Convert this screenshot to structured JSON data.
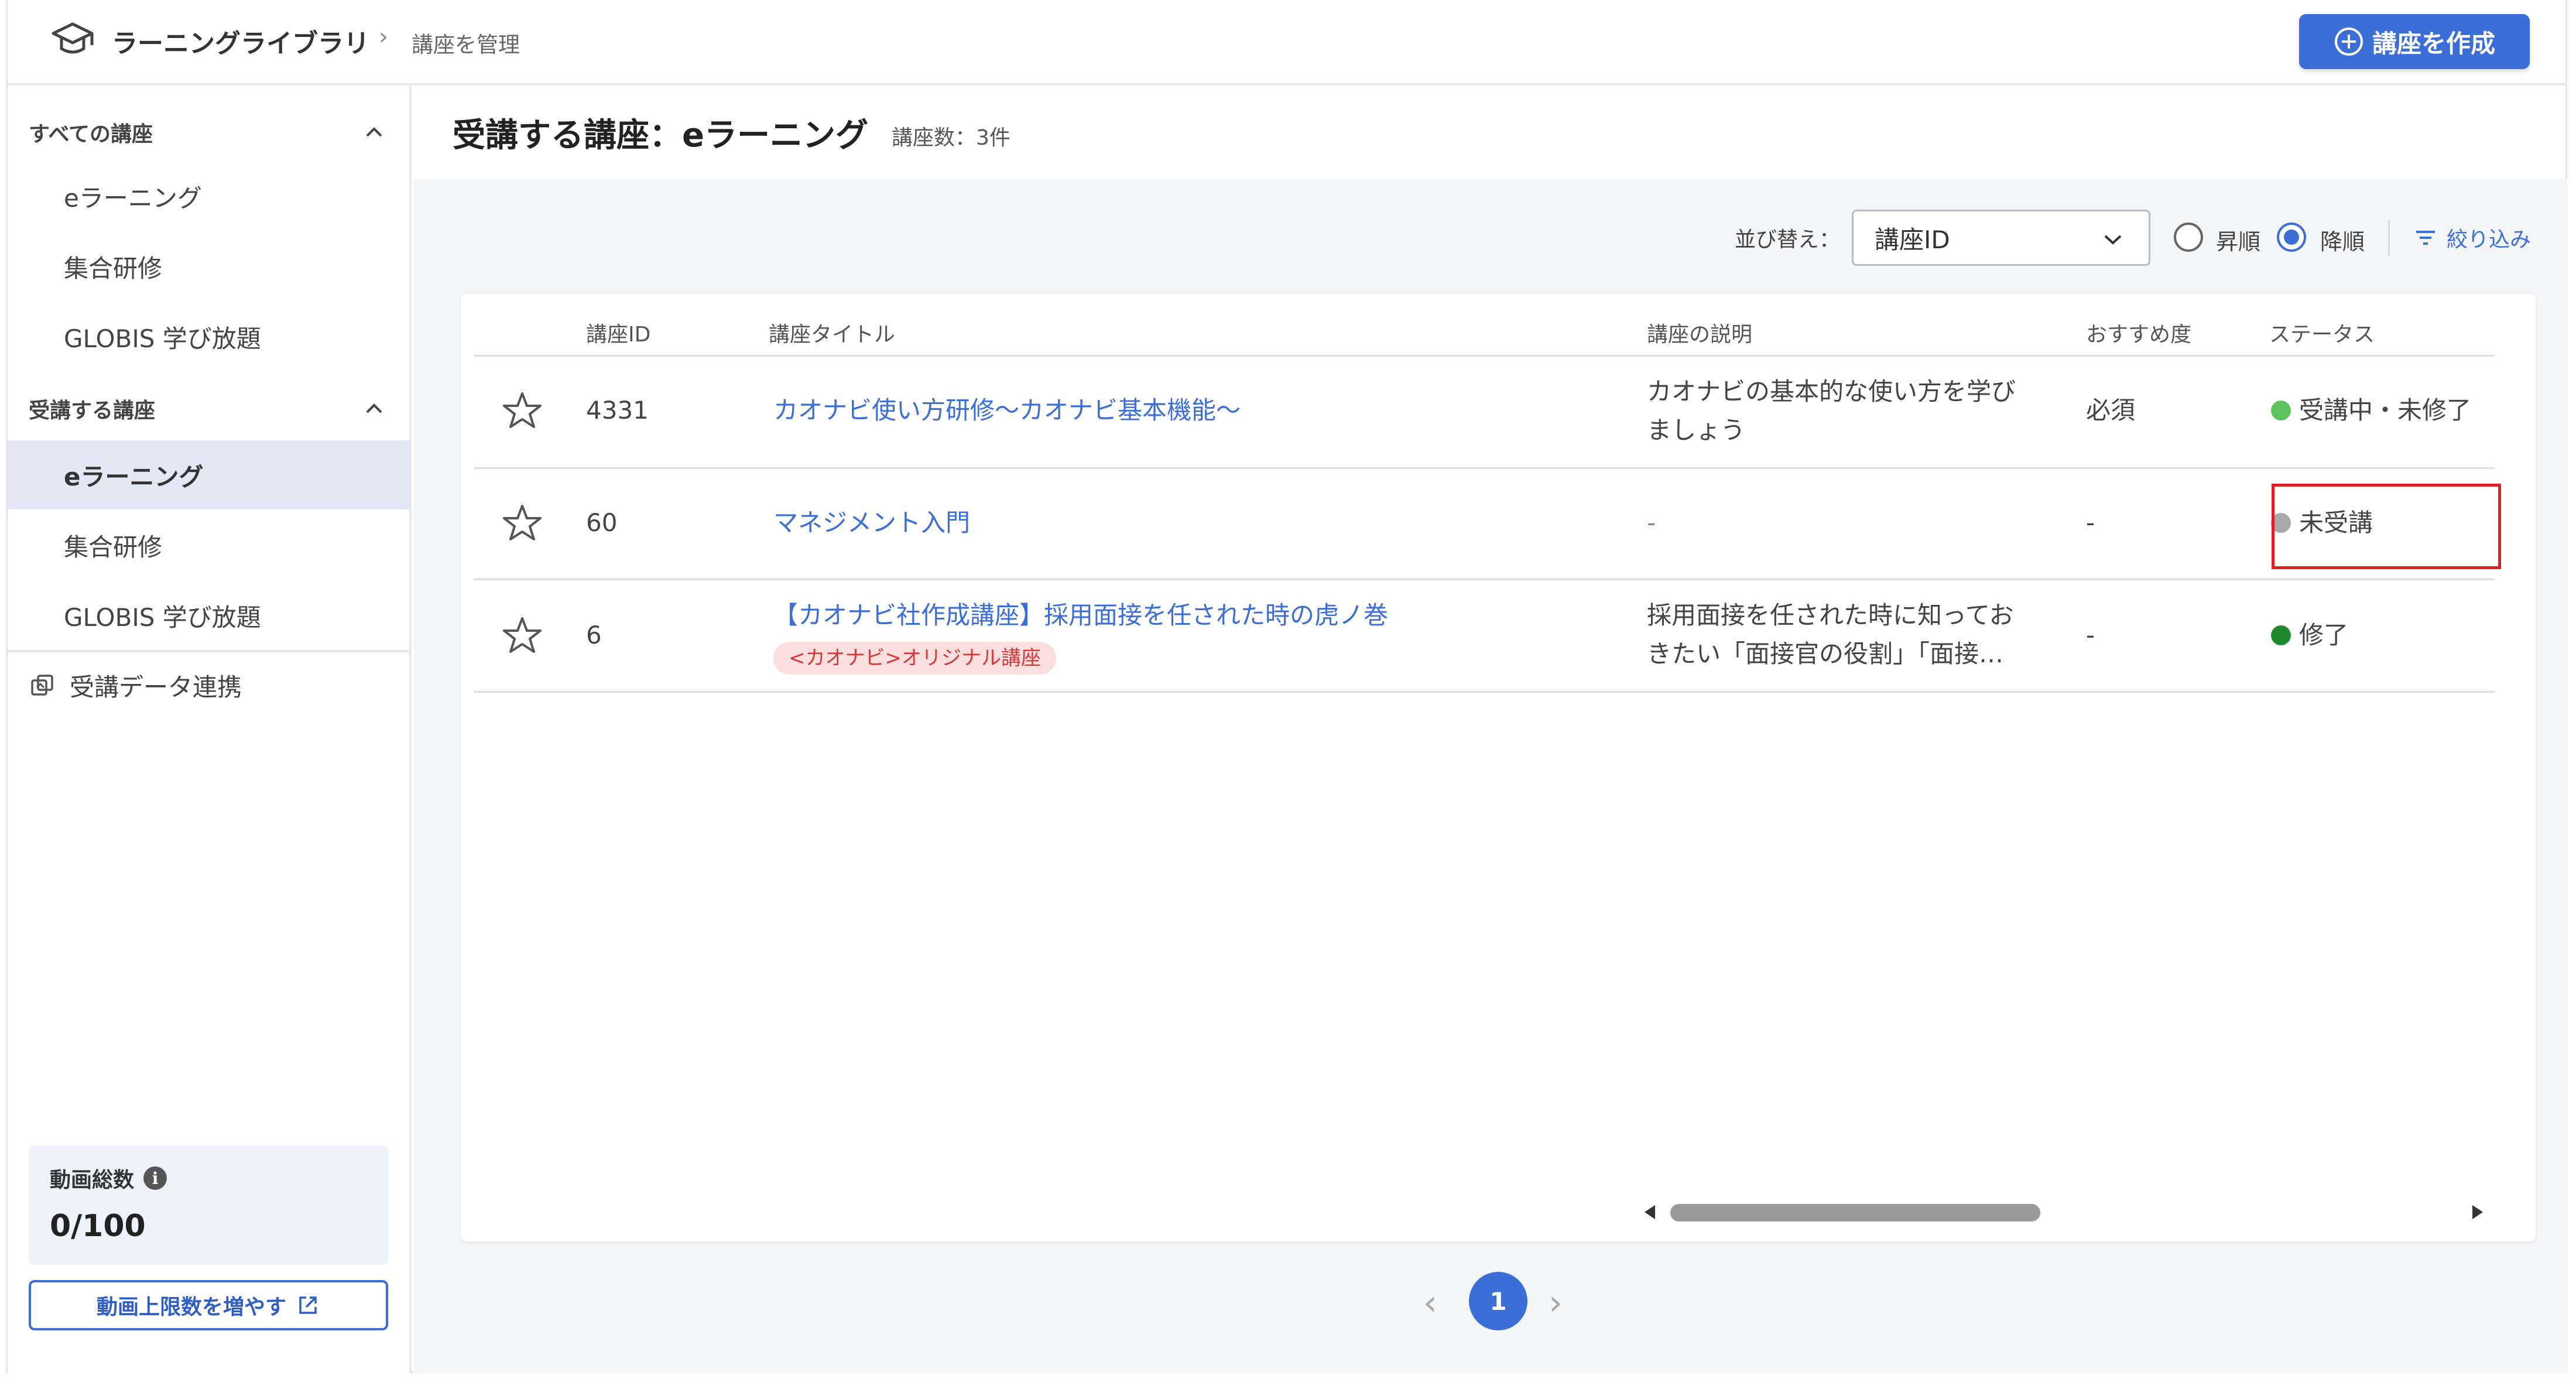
{
  "header": {
    "app_title": "ラーニングライブラリ",
    "breadcrumb_current": "講座を管理",
    "create_button": "講座を作成"
  },
  "sidebar": {
    "section_all": "すべての講座",
    "all_items": [
      "eラーニング",
      "集合研修",
      "GLOBIS 学び放題"
    ],
    "section_attending": "受講する講座",
    "attending_items": [
      "eラーニング",
      "集合研修",
      "GLOBIS 学び放題"
    ],
    "data_link": "受講データ連携",
    "video_total_label": "動画総数",
    "video_total_value": "0/100",
    "increase_button": "動画上限数を増やす"
  },
  "main": {
    "title": "受講する講座：eラーニング",
    "count": "講座数：3件",
    "sort_label": "並び替え：",
    "sort_value": "講座ID",
    "order_asc": "昇順",
    "order_desc": "降順",
    "filter_label": "絞り込み"
  },
  "table": {
    "headers": [
      "講座ID",
      "講座タイトル",
      "講座の説明",
      "おすすめ度",
      "ステータス"
    ],
    "rows": [
      {
        "id": "4331",
        "title": "カオナビ使い方研修〜カオナビ基本機能〜",
        "desc_line1": "カオナビの基本的な使い方を学び",
        "desc_line2": "ましょう",
        "recommend": "必須",
        "status": "受講中・未修了",
        "status_color": "#5cc45c"
      },
      {
        "id": "60",
        "title": "マネジメント入門",
        "desc_line1": "-",
        "desc_line2": "",
        "recommend": "-",
        "status": "未受講",
        "status_color": "#a8a8a8"
      },
      {
        "id": "6",
        "title": "【カオナビ社作成講座】採用面接を任された時の虎ノ巻",
        "tag": "<カオナビ>オリジナル講座",
        "desc_line1": "採用面接を任された時に知ってお",
        "desc_line2": "きたい「面接官の役割」「面接…",
        "recommend": "-",
        "status": "修了",
        "status_color": "#1f8a2c"
      }
    ]
  },
  "pagination": {
    "current": "1"
  },
  "colors": {
    "accent": "#3b6ed6",
    "highlight": "#e02020"
  }
}
